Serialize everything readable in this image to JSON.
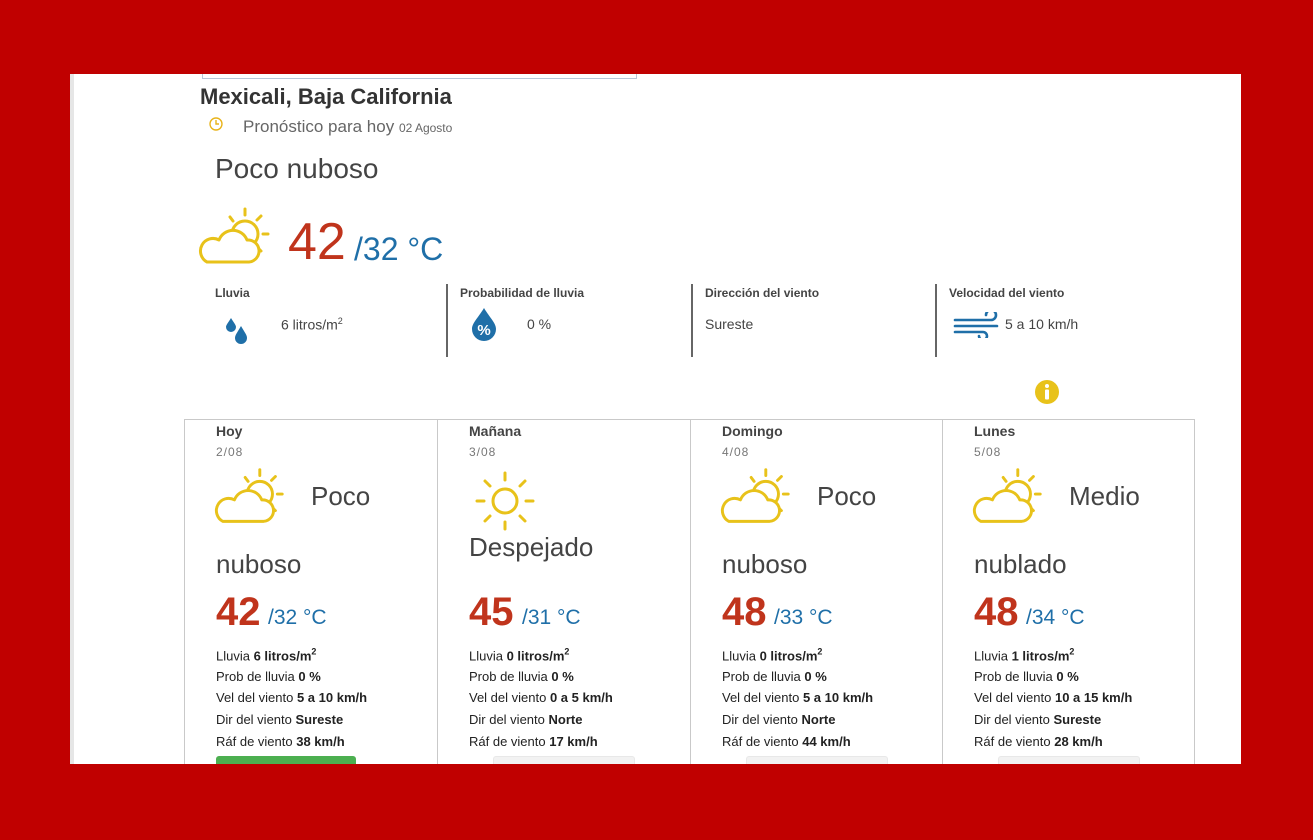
{
  "location": {
    "title": "Mexicali, Baja California"
  },
  "forecast": {
    "label": "Pronóstico para hoy",
    "date": "02 Agosto"
  },
  "current": {
    "description": "Poco nuboso",
    "icon": "partly-cloudy-icon",
    "temp_max": "42",
    "temp_min": "/32 °C"
  },
  "stats": [
    {
      "label": "Lluvia",
      "value": "6 litros/m",
      "sup": "2",
      "icon": "rain-drops-icon"
    },
    {
      "label": "Probabilidad de lluvia",
      "value": "0 %",
      "icon": "percent-drop-icon"
    },
    {
      "label": "Dirección del viento",
      "value": "Sureste"
    },
    {
      "label": "Velocidad del viento",
      "value": "5 a 10 km/h",
      "icon": "wind-icon"
    }
  ],
  "labels": {
    "rain": "Lluvia",
    "prob": "Prob de lluvia",
    "wind_speed": "Vel del viento",
    "wind_dir": "Dir del viento",
    "gust": "Ráf de viento",
    "sup2": "2"
  },
  "days": [
    {
      "name": "Hoy",
      "date": "2/08",
      "icon": "partly-cloudy-icon",
      "description": "Poco nuboso",
      "max": "42",
      "min": "/32 °C",
      "rain": "6 litros/m",
      "prob": "0 %",
      "wind_speed": "5 a 10 km/h",
      "wind_dir": "Sureste",
      "gust": "38 km/h"
    },
    {
      "name": "Mañana",
      "date": "3/08",
      "icon": "sun-icon",
      "description": "Despejado",
      "max": "45",
      "min": "/31 °C",
      "rain": "0 litros/m",
      "prob": "0 %",
      "wind_speed": "0 a 5 km/h",
      "wind_dir": "Norte",
      "gust": "17 km/h"
    },
    {
      "name": "Domingo",
      "date": "4/08",
      "icon": "partly-cloudy-icon",
      "description": "Poco nuboso",
      "max": "48",
      "min": "/33 °C",
      "rain": "0 litros/m",
      "prob": "0 %",
      "wind_speed": "5 a 10 km/h",
      "wind_dir": "Norte",
      "gust": "44 km/h"
    },
    {
      "name": "Lunes",
      "date": "5/08",
      "icon": "partly-cloudy-icon",
      "description": "Medio nublado",
      "max": "48",
      "min": "/34 °C",
      "rain": "1 litros/m",
      "prob": "0 %",
      "wind_speed": "10 a 15 km/h",
      "wind_dir": "Sureste",
      "gust": "28 km/h"
    }
  ],
  "colors": {
    "frame": "#c00000",
    "temp_max": "#c0341c",
    "temp_min": "#1f6fa8",
    "icon_yellow": "#e8c21a",
    "drop_blue": "#1f6fa8",
    "button_green": "#4caf50"
  }
}
